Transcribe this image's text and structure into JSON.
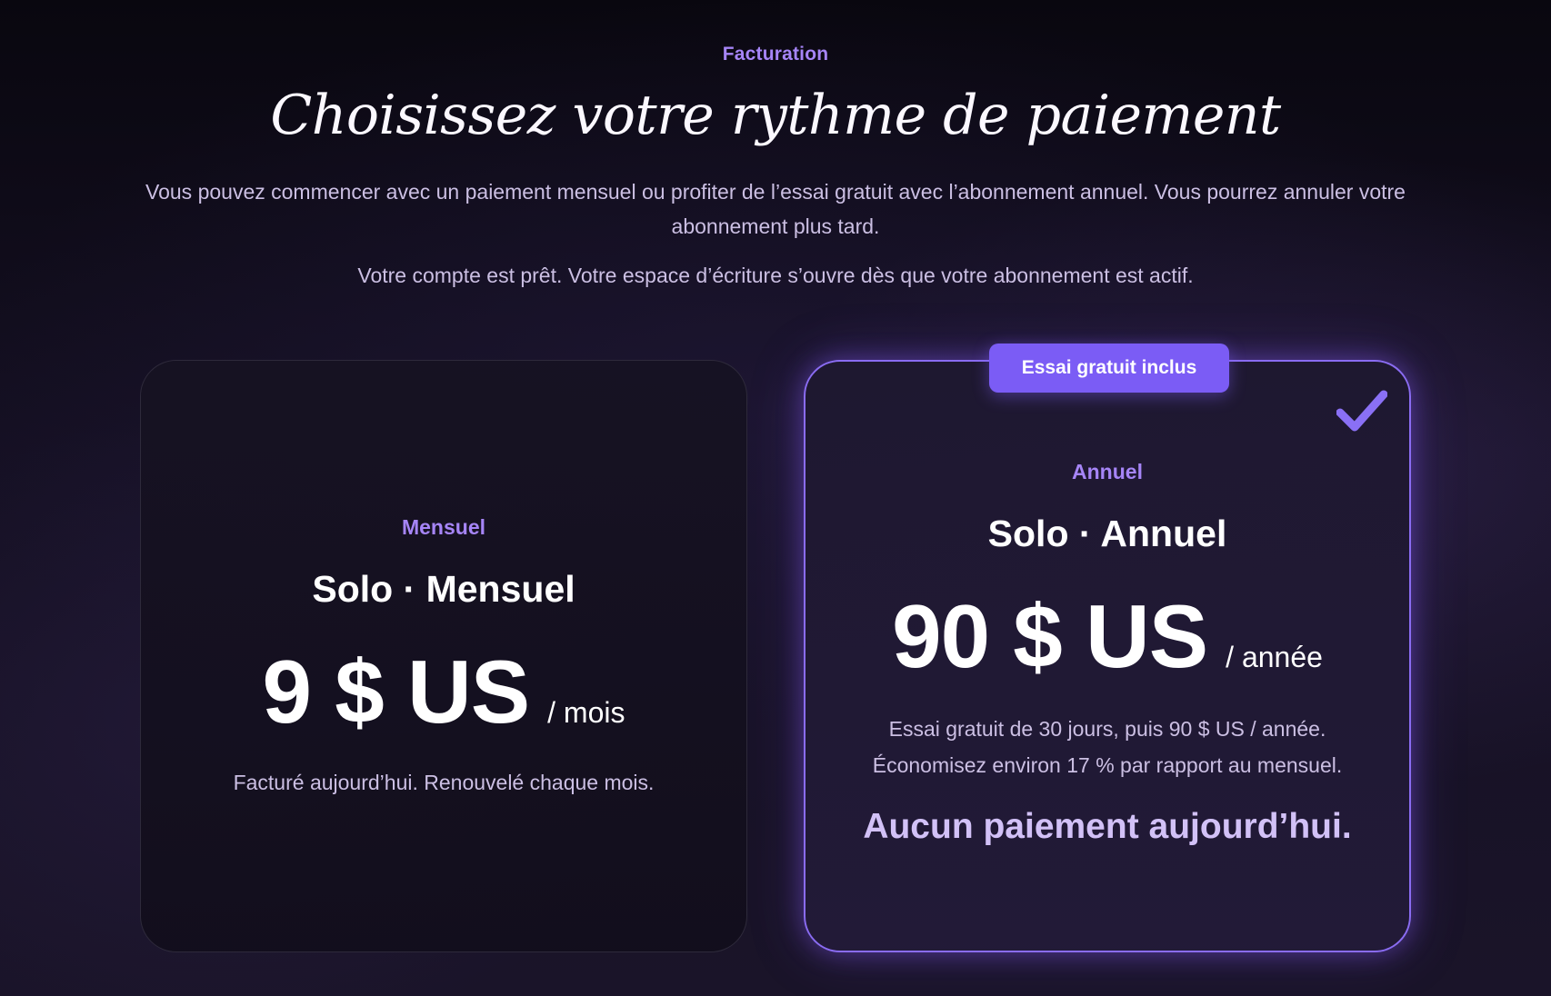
{
  "header": {
    "eyebrow": "Facturation",
    "title": "Choisissez votre rythme de paiement",
    "subtitle": "Vous pouvez commencer avec un paiement mensuel ou profiter de l’essai gratuit avec l’abonnement annuel. Vous pourrez annuler votre abonnement plus tard.",
    "ready_text": "Votre compte est prêt. Votre espace d’écriture s’ouvre dès que votre abonnement est actif."
  },
  "plans": {
    "monthly": {
      "tier": "Mensuel",
      "name": "Solo · Mensuel",
      "price": "9 $ US",
      "period": "/ mois",
      "note": "Facturé aujourd’hui. Renouvelé chaque mois.",
      "selected": false
    },
    "annual": {
      "badge": "Essai gratuit inclus",
      "tier": "Annuel",
      "name": "Solo · Annuel",
      "price": "90 $ US",
      "period": "/ année",
      "note_line1": "Essai gratuit de 30 jours, puis 90 $ US / année.",
      "note_line2": "Économisez environ 17 % par rapport au mensuel.",
      "highlight": "Aucun paiement aujourd’hui.",
      "selected": true,
      "icon": "check-icon"
    }
  },
  "colors": {
    "accent": "#a685f7",
    "badge_bg": "#7b5cf5",
    "selected_border": "#8a6cf2"
  }
}
